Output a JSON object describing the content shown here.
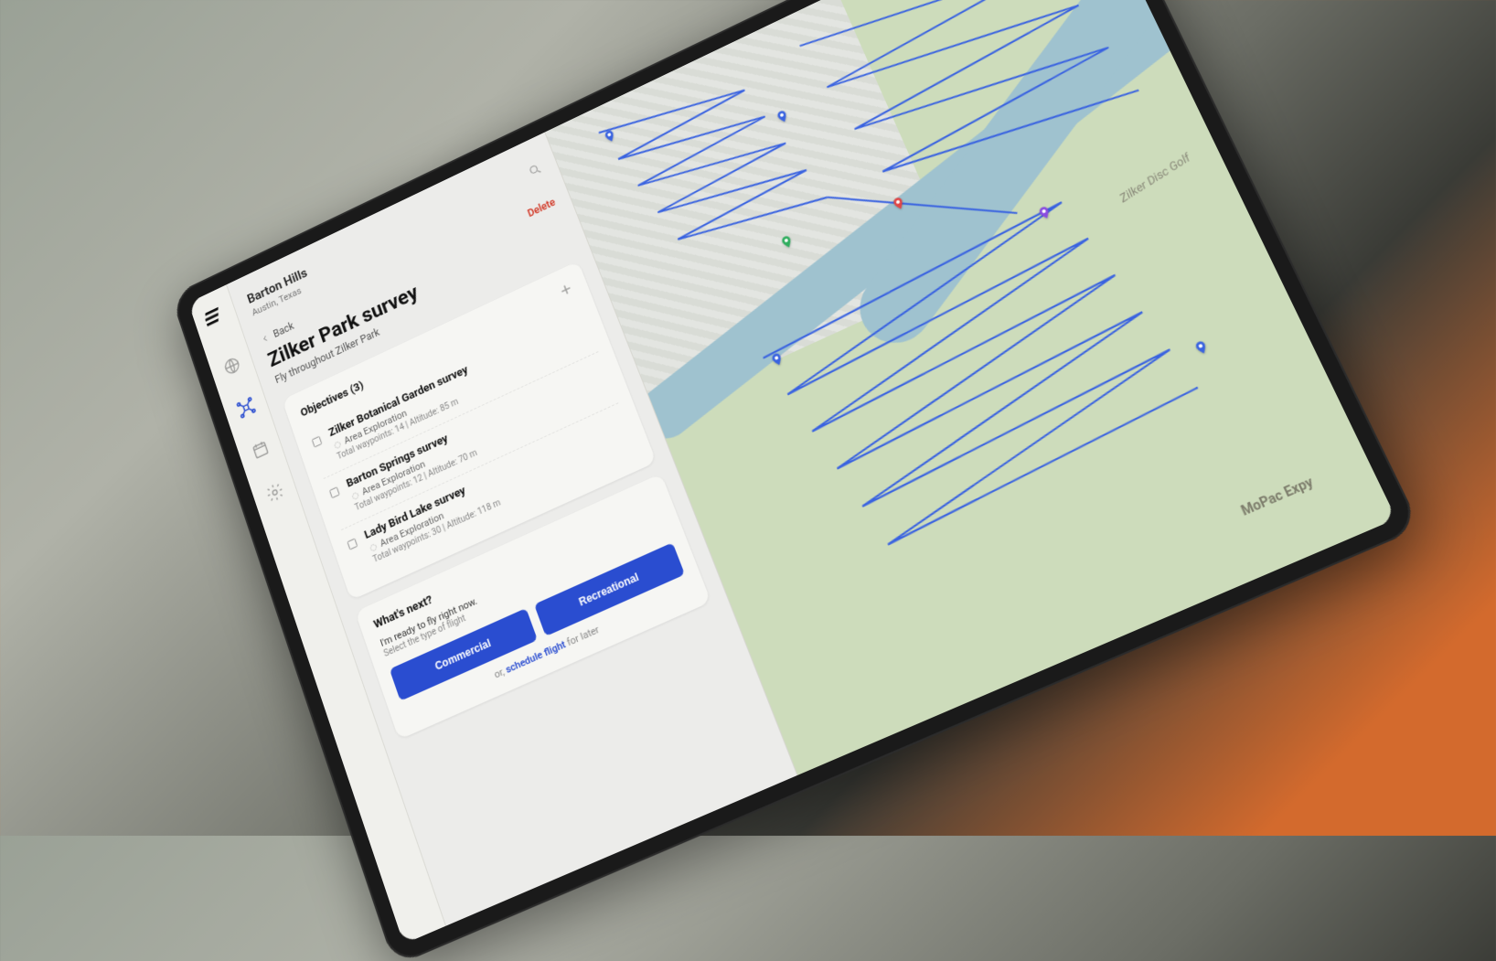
{
  "location": {
    "name": "Barton Hills",
    "sub": "Austin, Texas"
  },
  "nav": {
    "back_label": "Back",
    "delete_label": "Delete"
  },
  "survey": {
    "title": "Zilker Park survey",
    "subtitle": "Fly throughout Zilker Park"
  },
  "objectives": {
    "header": "Objectives (3)",
    "items": [
      {
        "name": "Zilker Botanical Garden survey",
        "type": "Area Exploration",
        "meta": "Total waypoints: 14 | Altitude: 85 m"
      },
      {
        "name": "Barton Springs survey",
        "type": "Area Exploration",
        "meta": "Total waypoints: 12 | Altitude: 70 m"
      },
      {
        "name": "Lady Bird Lake survey",
        "type": "Area Exploration",
        "meta": "Total waypoints: 30 | Altitude: 118 m"
      }
    ]
  },
  "next": {
    "title": "What's next?",
    "ready": "I'm ready to fly right now.",
    "select": "Select the type of flight",
    "btn_commercial": "Commercial",
    "btn_recreational": "Recreational",
    "or_prefix": "or, ",
    "schedule_link": "schedule flight",
    "or_suffix": " for later"
  },
  "map": {
    "park_label": "Zilker Disc Golf",
    "road_label": "MoPac Expy"
  }
}
